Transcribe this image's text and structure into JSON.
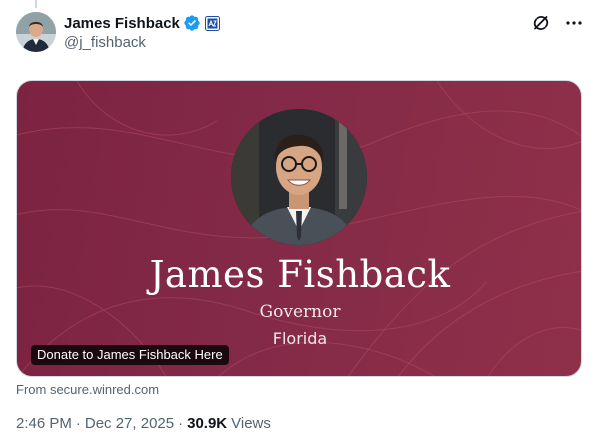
{
  "author": {
    "display_name": "James Fishback",
    "handle": "@j_fishback",
    "verified": true,
    "affiliation_badge": "affiliate-badge-icon"
  },
  "header_icons": [
    "grok-icon",
    "more-icon"
  ],
  "link_card": {
    "title": "James Fishback",
    "subtitle": "Governor",
    "location": "Florida",
    "link_label": "Donate to James Fishback Here",
    "source": "From secure.winred.com",
    "background_color": "#832a48"
  },
  "meta": {
    "time": "2:46 PM",
    "separator": "·",
    "date": "Dec 27, 2025",
    "views_count": "30.9K",
    "views_label": "Views"
  },
  "colors": {
    "verified_blue": "#1d9bf0",
    "secondary_text": "#536471",
    "primary_text": "#0f1419"
  }
}
